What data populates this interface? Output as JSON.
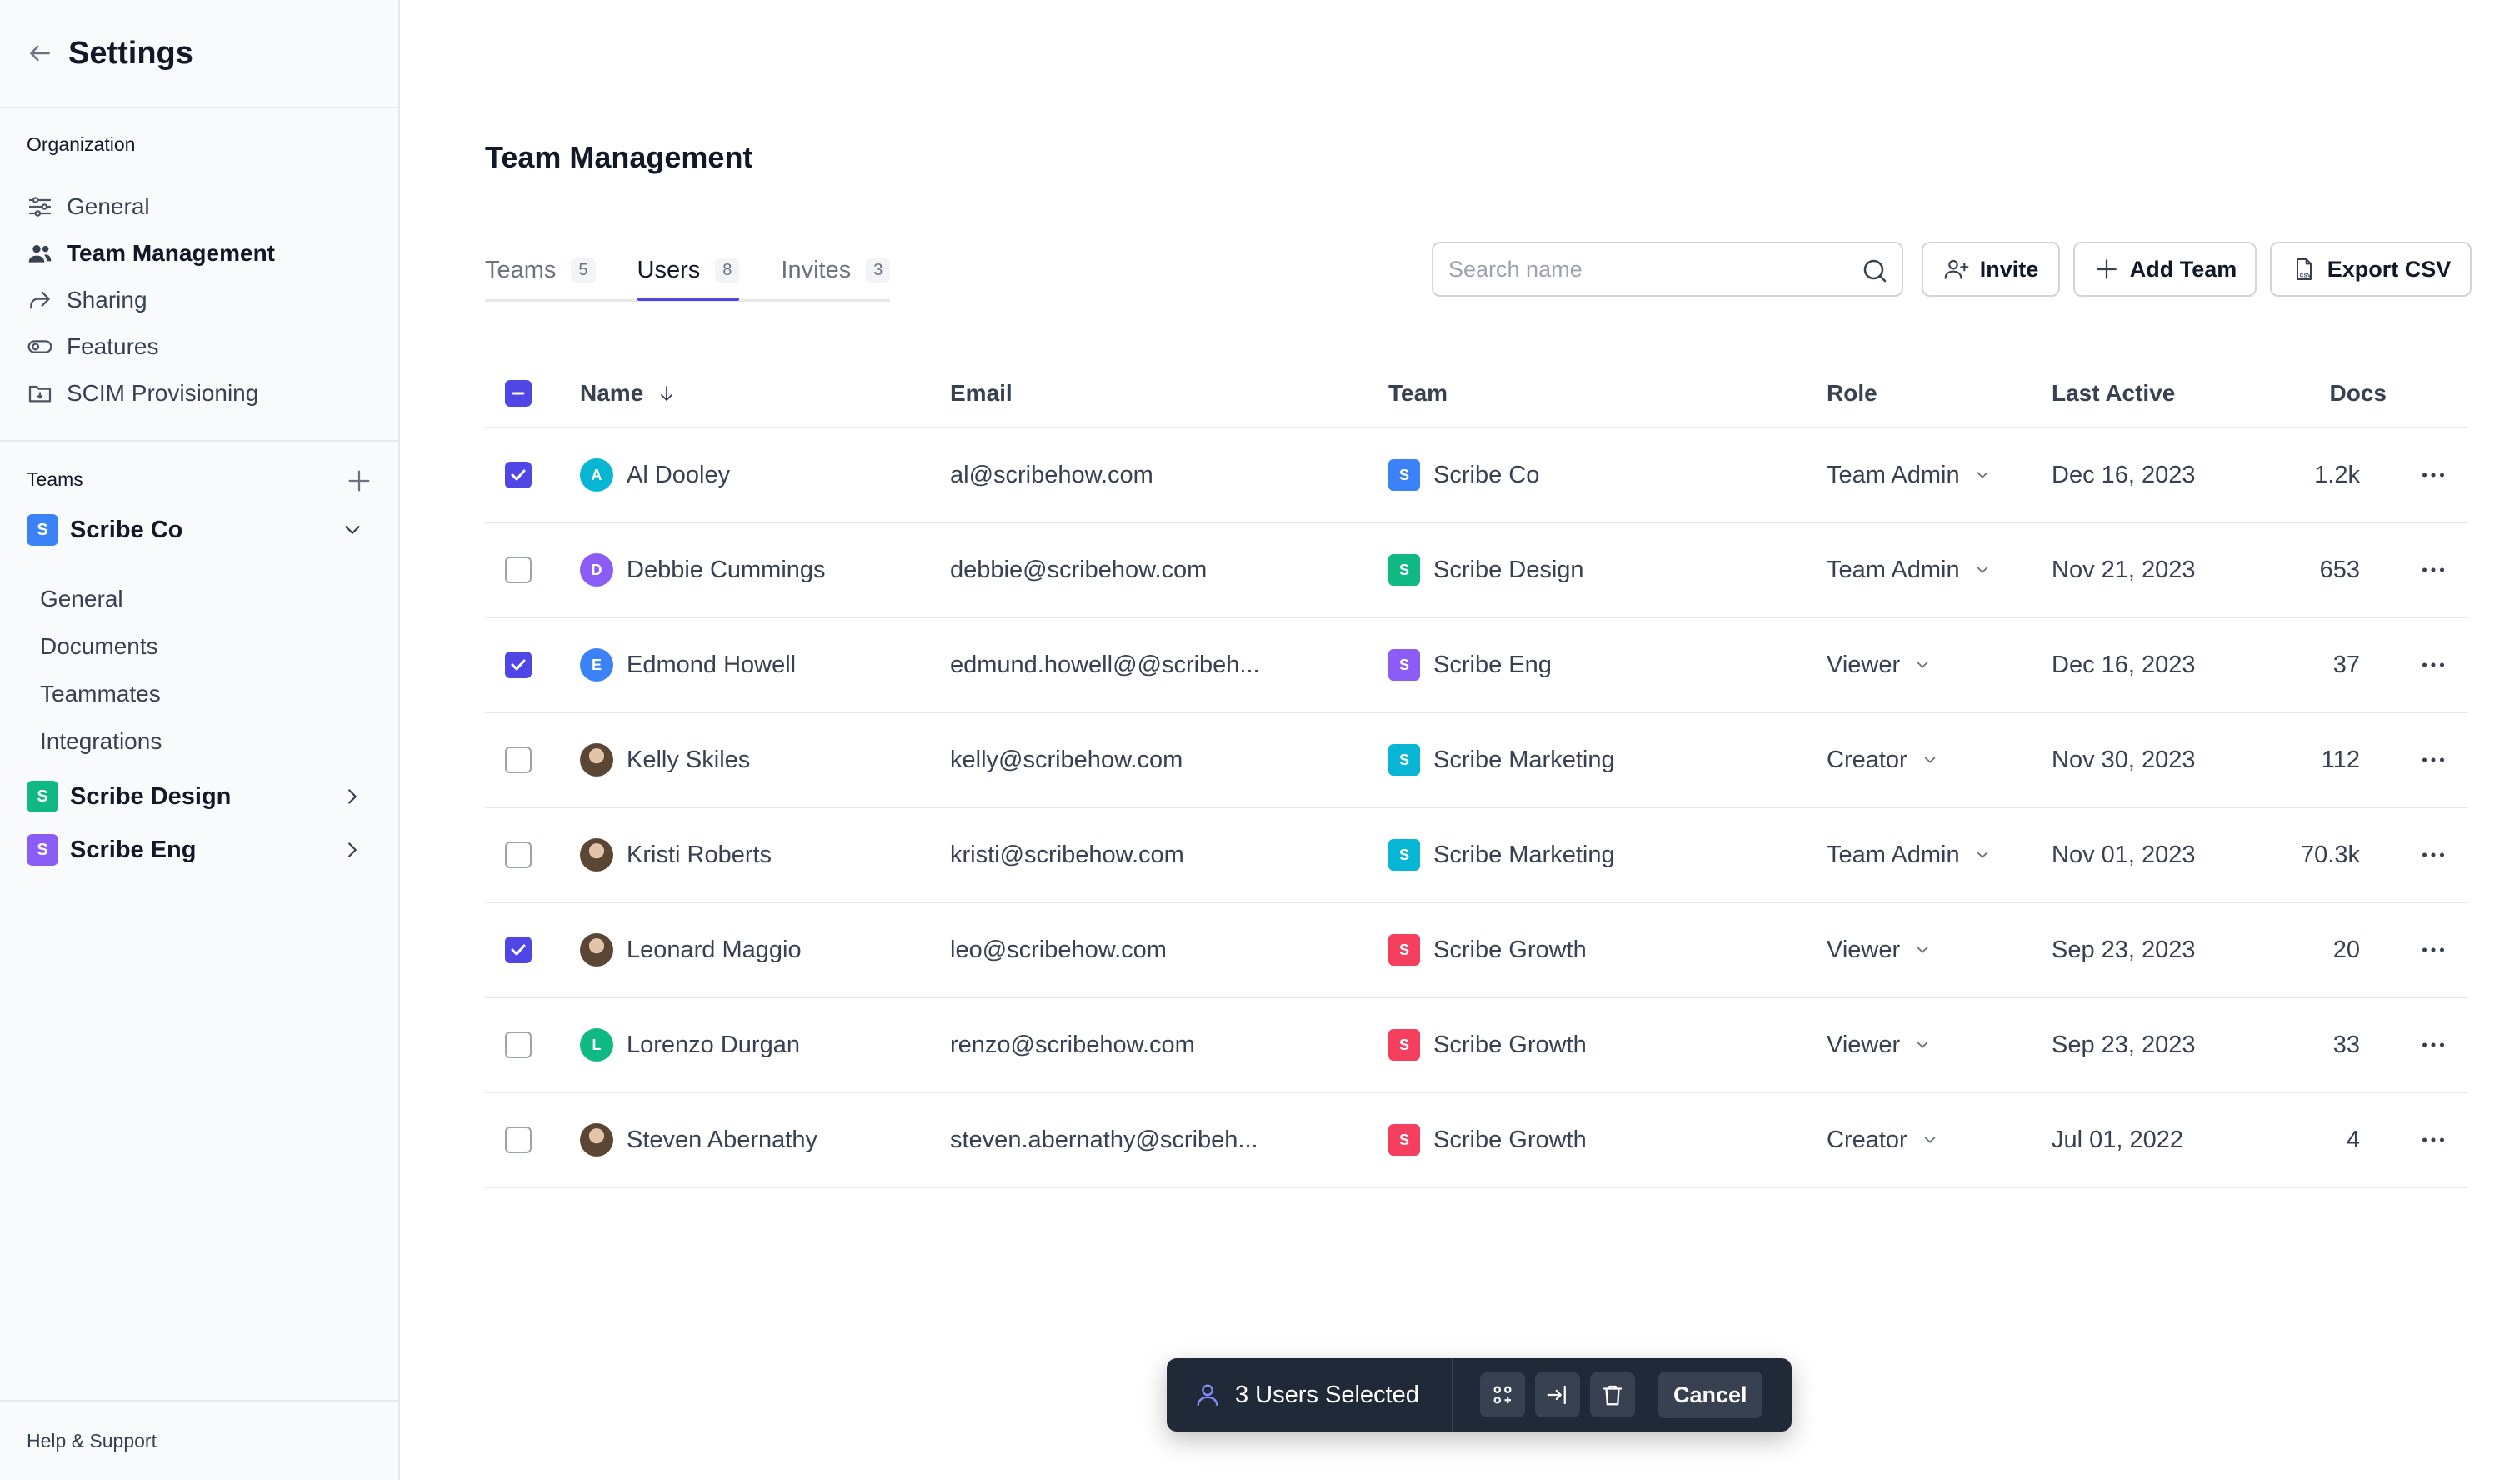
{
  "sidebar": {
    "title": "Settings",
    "org_label": "Organization",
    "nav": [
      {
        "label": "General",
        "icon": "sliders-icon"
      },
      {
        "label": "Team Management",
        "icon": "users-icon"
      },
      {
        "label": "Sharing",
        "icon": "share-icon"
      },
      {
        "label": "Features",
        "icon": "toggle-icon"
      },
      {
        "label": "SCIM Provisioning",
        "icon": "folder-icon"
      }
    ],
    "teams_label": "Teams",
    "teams": [
      {
        "label": "Scribe Co",
        "badge": "S",
        "color": "#3b82f6"
      },
      {
        "label": "Scribe Design",
        "badge": "S",
        "color": "#10b981"
      },
      {
        "label": "Scribe Eng",
        "badge": "S",
        "color": "#8b5cf6"
      }
    ],
    "team_sub": [
      "General",
      "Documents",
      "Teammates",
      "Integrations"
    ],
    "footer": "Help & Support"
  },
  "main": {
    "title": "Team Management",
    "tabs": [
      {
        "label": "Teams",
        "count": "5"
      },
      {
        "label": "Users",
        "count": "8"
      },
      {
        "label": "Invites",
        "count": "3"
      }
    ],
    "search_placeholder": "Search name",
    "buttons": {
      "invite": "Invite",
      "add_team": "Add Team",
      "export": "Export CSV"
    }
  },
  "table": {
    "headers": {
      "name": "Name",
      "email": "Email",
      "team": "Team",
      "role": "Role",
      "last_active": "Last Active",
      "docs": "Docs"
    },
    "rows": [
      {
        "checked": true,
        "avatar": "A",
        "avatar_color": "#06b6d4",
        "name": "Al Dooley",
        "email": "al@scribehow.com",
        "team": "Scribe Co",
        "team_color": "#3b82f6",
        "role": "Team Admin",
        "last_active": "Dec 16, 2023",
        "docs": "1.2k"
      },
      {
        "checked": false,
        "avatar": "D",
        "avatar_color": "#8b5cf6",
        "name": "Debbie Cummings",
        "email": "debbie@scribehow.com",
        "team": "Scribe Design",
        "team_color": "#10b981",
        "role": "Team Admin",
        "last_active": "Nov 21, 2023",
        "docs": "653"
      },
      {
        "checked": true,
        "avatar": "E",
        "avatar_color": "#3b82f6",
        "name": "Edmond Howell",
        "email": "edmund.howell@@scribeh...",
        "team": "Scribe Eng",
        "team_color": "#8b5cf6",
        "role": "Viewer",
        "last_active": "Dec 16, 2023",
        "docs": "37"
      },
      {
        "checked": false,
        "avatar": "photo",
        "avatar_color": "#6b4f3a",
        "name": "Kelly Skiles",
        "email": "kelly@scribehow.com",
        "team": "Scribe Marketing",
        "team_color": "#06b6d4",
        "role": "Creator",
        "last_active": "Nov 30, 2023",
        "docs": "112"
      },
      {
        "checked": false,
        "avatar": "photo",
        "avatar_color": "#6b4f3a",
        "name": "Kristi Roberts",
        "email": "kristi@scribehow.com",
        "team": "Scribe Marketing",
        "team_color": "#06b6d4",
        "role": "Team Admin",
        "last_active": "Nov 01, 2023",
        "docs": "70.3k"
      },
      {
        "checked": true,
        "avatar": "photo",
        "avatar_color": "#6b4f3a",
        "name": "Leonard Maggio",
        "email": "leo@scribehow.com",
        "team": "Scribe Growth",
        "team_color": "#f43f5e",
        "role": "Viewer",
        "last_active": "Sep 23, 2023",
        "docs": "20"
      },
      {
        "checked": false,
        "avatar": "L",
        "avatar_color": "#10b981",
        "name": "Lorenzo Durgan",
        "email": "renzo@scribehow.com",
        "team": "Scribe Growth",
        "team_color": "#f43f5e",
        "role": "Viewer",
        "last_active": "Sep 23, 2023",
        "docs": "33"
      },
      {
        "checked": false,
        "avatar": "photo",
        "avatar_color": "#6b4f3a",
        "name": "Steven Abernathy",
        "email": "steven.abernathy@scribeh...",
        "team": "Scribe Growth",
        "team_color": "#f43f5e",
        "role": "Creator",
        "last_active": "Jul 01, 2022",
        "docs": "4"
      }
    ]
  },
  "bulk_bar": {
    "selected_label": "3 Users Selected",
    "cancel": "Cancel"
  },
  "colors": {
    "accent": "#4f46e5",
    "bulk_bg": "#1f2937"
  }
}
